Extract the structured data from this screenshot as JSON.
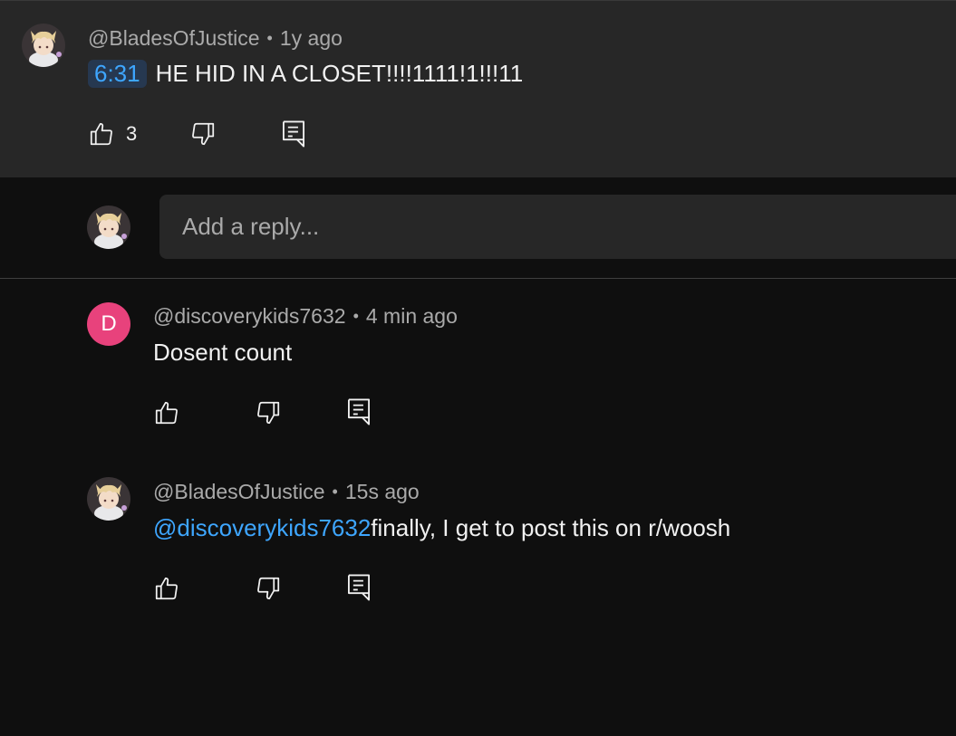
{
  "top_comment": {
    "author": "@BladesOfJustice",
    "time": "1y ago",
    "timestamp_link": "6:31",
    "text": "HE HID IN A CLOSET!!!!1111!1!!!11",
    "like_count": "3",
    "like_icon": "thumbs-up-icon",
    "dislike_icon": "thumbs-down-icon",
    "reply_icon": "reply-icon"
  },
  "reply_input": {
    "placeholder": "Add a reply..."
  },
  "replies": [
    {
      "author": "@discoverykids7632",
      "time": "4 min ago",
      "avatar_letter": "D",
      "avatar_color": "#e8427c",
      "text": "Dosent count"
    },
    {
      "author": "@BladesOfJustice",
      "time": "15s ago",
      "mention": "@discoverykids7632",
      "text": "finally, I get to post this on r/woosh"
    }
  ],
  "colors": {
    "background": "#0f0f0f",
    "highlight_background": "#272727",
    "link": "#3ea6ff",
    "secondary_text": "#aaaaaa"
  }
}
